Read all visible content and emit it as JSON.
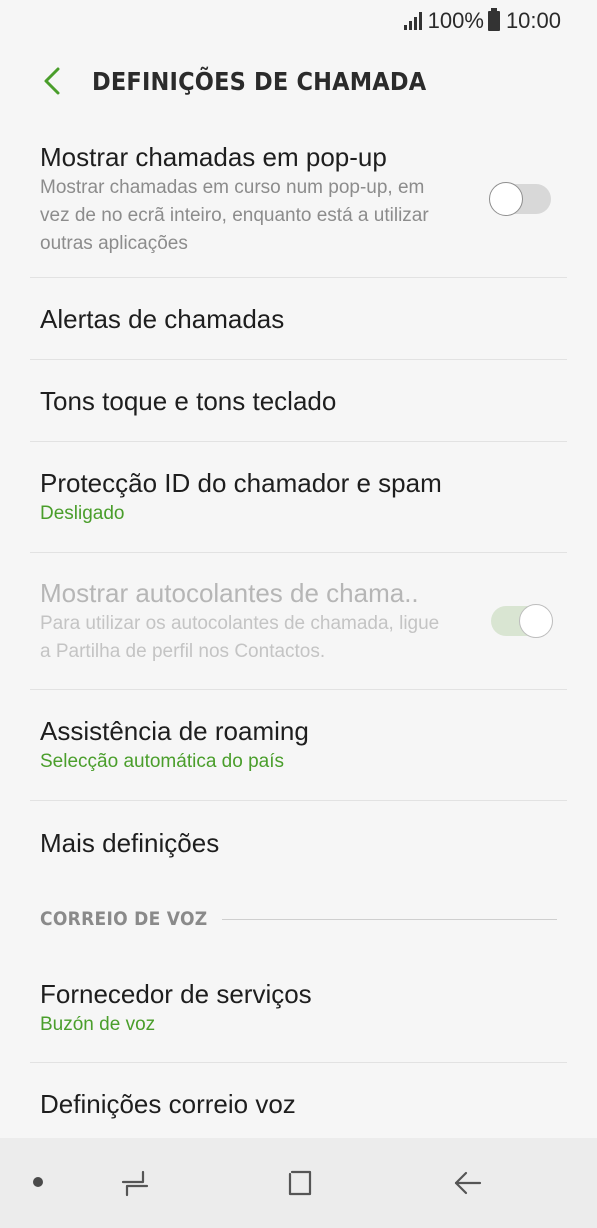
{
  "status_bar": {
    "battery_percent": "100%",
    "time": "10:00"
  },
  "header": {
    "title": "DEFINIÇÕES DE CHAMADA"
  },
  "settings": [
    {
      "title": "Mostrar chamadas em pop-up",
      "subtitle": "Mostrar chamadas em curso num pop-up, em vez de no ecrã inteiro, enquanto está a utilizar outras aplicações",
      "toggle": "off"
    },
    {
      "title": "Alertas de chamadas"
    },
    {
      "title": "Tons toque e tons teclado"
    },
    {
      "title": "Protecção ID do chamador e spam",
      "subtitle": "Desligado"
    },
    {
      "title": "Mostrar autocolantes de chama..",
      "subtitle": "Para utilizar os autocolantes de chamada, ligue a Partilha de perfil nos Contactos.",
      "toggle": "on",
      "disabled": true
    },
    {
      "title": "Assistência de roaming",
      "subtitle": "Selecção automática do país"
    },
    {
      "title": "Mais definições"
    }
  ],
  "voicemail_section": {
    "label": "CORREIO DE VOZ",
    "items": [
      {
        "title": "Fornecedor de serviços",
        "subtitle": "Buzón de voz"
      },
      {
        "title": "Definições correio voz"
      }
    ]
  },
  "colors": {
    "accent_green": "#4a9e2b",
    "background": "#f6f6f6",
    "nav_bar": "#ececec"
  },
  "icons": {
    "back": "chevron-left-icon",
    "recents": "recent-apps-icon",
    "home": "home-icon",
    "nav_back": "back-arrow-icon"
  }
}
